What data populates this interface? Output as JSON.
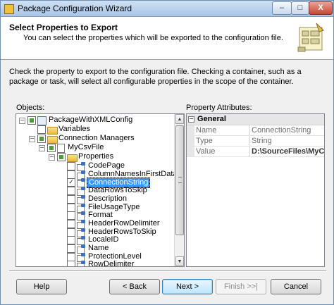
{
  "window": {
    "title": "Package Configuration Wizard",
    "minimize": "–",
    "maximize": "□",
    "close": "X"
  },
  "header": {
    "title": "Select Properties to Export",
    "subtitle": "You can select the properties which will be exported to the configuration file."
  },
  "description": "Check the property to export to the configuration file. Checking a container, such as a package or task, will select all configurable properties in the scope of the container.",
  "objects_label": "Objects:",
  "properties_label": "Property Attributes:",
  "tree": {
    "package": "PackageWithXMLConfig",
    "variables": "Variables",
    "connection_managers": "Connection Managers",
    "connection": "MyCsvFile",
    "properties": "Properties",
    "items": [
      {
        "label": "CodePage",
        "checked": false
      },
      {
        "label": "ColumnNamesInFirstDataRow",
        "checked": false
      },
      {
        "label": "ConnectionString",
        "checked": true
      },
      {
        "label": "DataRowsToSkip",
        "checked": false
      },
      {
        "label": "Description",
        "checked": false
      },
      {
        "label": "FileUsageType",
        "checked": false
      },
      {
        "label": "Format",
        "checked": false
      },
      {
        "label": "HeaderRowDelimiter",
        "checked": false
      },
      {
        "label": "HeaderRowsToSkip",
        "checked": false
      },
      {
        "label": "LocaleID",
        "checked": false
      },
      {
        "label": "Name",
        "checked": false
      },
      {
        "label": "ProtectionLevel",
        "checked": false
      },
      {
        "label": "RowDelimiter",
        "checked": false
      }
    ]
  },
  "property_grid": {
    "category": "General",
    "rows": [
      {
        "key": "Name",
        "value": "ConnectionString"
      },
      {
        "key": "Type",
        "value": "String"
      },
      {
        "key": "Value",
        "value": "D:\\SourceFiles\\MyCsvFil"
      }
    ]
  },
  "buttons": {
    "help": "Help",
    "back": "< Back",
    "next": "Next >",
    "finish": "Finish >>|",
    "cancel": "Cancel"
  }
}
